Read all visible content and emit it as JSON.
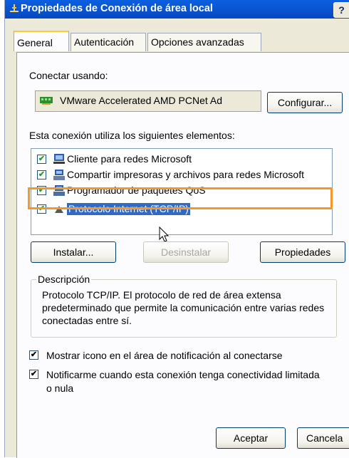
{
  "window": {
    "title": "Propiedades de Conexión de área local",
    "help_label": "?"
  },
  "tabs": [
    {
      "label": "General",
      "active": true
    },
    {
      "label": "Autenticación",
      "active": false
    },
    {
      "label": "Opciones avanzadas",
      "active": false
    }
  ],
  "connect": {
    "label": "Conectar usando:",
    "adapter_name": "VMware Accelerated AMD PCNet Ad",
    "configure_button": "Configurar..."
  },
  "components": {
    "label": "Esta conexión utiliza los siguientes elementos:",
    "items": [
      {
        "label": "Cliente para redes Microsoft",
        "checked": true,
        "icon": "network-client-icon"
      },
      {
        "label": "Compartir impresoras y archivos para redes Microsoft",
        "checked": true,
        "icon": "file-printer-sharing-icon"
      },
      {
        "label": "Programador de paquetes QoS",
        "checked": true,
        "icon": "qos-scheduler-icon"
      },
      {
        "label": "Protocolo Internet (TCP/IP)",
        "checked": true,
        "icon": "protocol-icon",
        "selected": true
      }
    ],
    "install_button": "Instalar...",
    "uninstall_button": "Desinstalar",
    "properties_button": "Propiedades"
  },
  "description": {
    "legend": "Descripción",
    "text": "Protocolo TCP/IP. El protocolo de red de área extensa predeterminado que permite la comunicación entre varias redes conectadas entre sí."
  },
  "options": {
    "show_icon": {
      "label": "Mostrar icono en el área de notificación al conectarse",
      "checked": true
    },
    "notify": {
      "label": "Notificarme cuando esta conexión tenga conectividad limitada",
      "label_line2": "o nula",
      "checked": true
    }
  },
  "footer": {
    "ok_button": "Aceptar",
    "cancel_button": "Cancela"
  },
  "colors": {
    "titlebar": "#0a56d3",
    "selection": "#316ac5",
    "annotation_highlight": "#f5962a"
  }
}
